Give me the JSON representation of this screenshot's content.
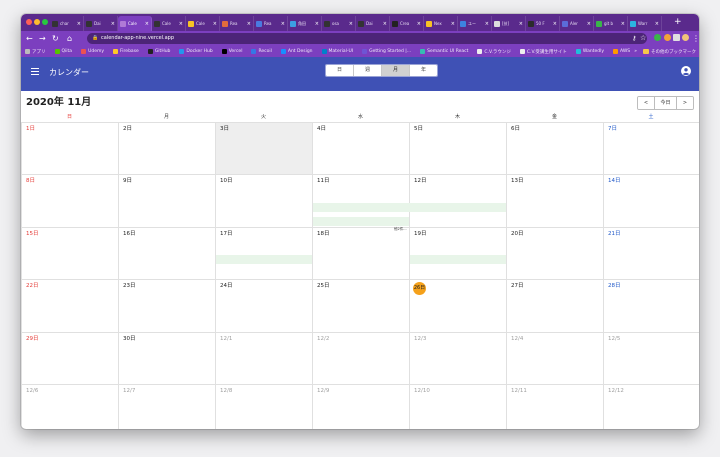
{
  "browser": {
    "tabs": [
      {
        "label": "char",
        "color": "#333333",
        "active": false
      },
      {
        "label": "Dai",
        "color": "#333333",
        "active": false
      },
      {
        "label": "Cale",
        "color": "#b07ad6",
        "active": true
      },
      {
        "label": "Cale",
        "color": "#333333",
        "active": false
      },
      {
        "label": "Cale",
        "color": "#f7c325",
        "active": false
      },
      {
        "label": "Rea",
        "color": "#e36b3c",
        "active": false
      },
      {
        "label": "Rea",
        "color": "#4a7be0",
        "active": false
      },
      {
        "label": "角田",
        "color": "#3ca0e3",
        "active": false
      },
      {
        "label": "osa",
        "color": "#333333",
        "active": false
      },
      {
        "label": "Dai",
        "color": "#333333",
        "active": false
      },
      {
        "label": "Crea",
        "color": "#222222",
        "active": false
      },
      {
        "label": "Nex",
        "color": "#f7c325",
        "active": false
      },
      {
        "label": "ユー",
        "color": "#3d82e0",
        "active": false
      },
      {
        "label": "[技]",
        "color": "#dddddd",
        "active": false
      },
      {
        "label": "50 F",
        "color": "#2b2b2b",
        "active": false
      },
      {
        "label": "Aler",
        "color": "#5b6bd8",
        "active": false
      },
      {
        "label": "git b",
        "color": "#3ab54a",
        "active": false
      },
      {
        "label": "Warr",
        "color": "#2bb3e0",
        "active": false
      }
    ],
    "tab_close": "×",
    "new_tab": "+",
    "url": "calendar-app-nine.vercel.app",
    "bookmarks": [
      {
        "label": "アプリ",
        "color": "#bbbbbb"
      },
      {
        "label": "Qiita",
        "color": "#55c500"
      },
      {
        "label": "Udemy",
        "color": "#ec5252"
      },
      {
        "label": "Firebase",
        "color": "#ffca28"
      },
      {
        "label": "GitHub",
        "color": "#222222"
      },
      {
        "label": "Docker Hub",
        "color": "#2496ed"
      },
      {
        "label": "Vercel",
        "color": "#000000"
      },
      {
        "label": "Recoil",
        "color": "#3578e5"
      },
      {
        "label": "Ant Design",
        "color": "#1890ff"
      },
      {
        "label": "Material-UI",
        "color": "#0081cb"
      },
      {
        "label": "Getting Started |...",
        "color": "#6e55d4"
      },
      {
        "label": "Semantic UI React",
        "color": "#35bdb2"
      },
      {
        "label": "C.V.ラウンジ",
        "color": "#eeeeee"
      },
      {
        "label": "C.V.受講生用サイト",
        "color": "#eeeeee"
      },
      {
        "label": "Wantedly",
        "color": "#21bddb"
      },
      {
        "label": "AWS",
        "color": "#ff9900"
      }
    ],
    "bookmarks_overflow": "»",
    "other_bookmarks": "その他のブックマーク"
  },
  "app": {
    "title": "カレンダー",
    "view_options": [
      "日",
      "週",
      "月",
      "年"
    ],
    "selected_view": "月",
    "brand_color": "#3f51b5"
  },
  "toolbar": {
    "month_label": "2020年 11月",
    "prev": "<",
    "today": "今日",
    "next": ">"
  },
  "calendar": {
    "weekdays": [
      "日",
      "月",
      "火",
      "水",
      "木",
      "金",
      "土"
    ],
    "weeks": [
      [
        "1日",
        "2日",
        "3日",
        "4日",
        "5日",
        "6日",
        "7日"
      ],
      [
        "8日",
        "9日",
        "10日",
        "11日",
        "12日",
        "13日",
        "14日"
      ],
      [
        "15日",
        "16日",
        "17日",
        "18日",
        "19日",
        "20日",
        "21日"
      ],
      [
        "22日",
        "23日",
        "24日",
        "25日",
        "26日",
        "27日",
        "28日"
      ],
      [
        "29日",
        "30日",
        "12/1",
        "12/2",
        "12/3",
        "12/4",
        "12/5"
      ],
      [
        "12/6",
        "12/7",
        "12/8",
        "12/9",
        "12/10",
        "12/11",
        "12/12"
      ]
    ],
    "highlighted_day": "3日",
    "today": "26日",
    "more_label": "他2件...",
    "event_color": "#e8f5e9"
  }
}
